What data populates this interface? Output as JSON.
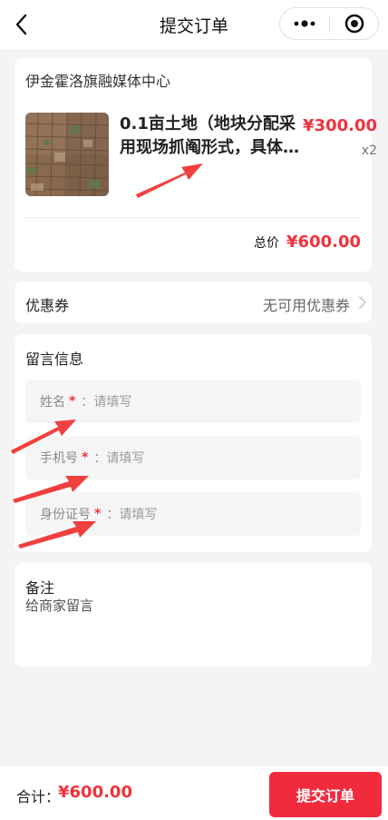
{
  "nav": {
    "title": "提交订单",
    "back_icon": "chevron-left-icon",
    "more_icon": "more-dots-icon",
    "close_icon": "target-circle-icon"
  },
  "shop": {
    "name": "伊金霍洛旗融媒体中心",
    "product": {
      "title": "0.1亩土地（地块分配采用现场抓阄形式，具体…",
      "price": "¥300.00",
      "qty": "x2",
      "image": "aerial-farmland-image"
    },
    "total_label": "总价",
    "total_value": "¥600.00"
  },
  "coupon": {
    "label": "优惠券",
    "value": "无可用优惠券"
  },
  "message": {
    "title": "留言信息",
    "fields": [
      {
        "label": "姓名",
        "required": "*",
        "placeholder": "：请填写"
      },
      {
        "label": "手机号",
        "required": "*",
        "placeholder": "：请填写"
      },
      {
        "label": "身份证号",
        "required": "*",
        "placeholder": "：请填写"
      }
    ]
  },
  "note": {
    "title": "备注",
    "placeholder": "给商家留言"
  },
  "footer": {
    "sum_label": "合计：",
    "sum_value": "¥600.00",
    "submit_label": "提交订单"
  },
  "colors": {
    "accent": "#f0323c",
    "button": "#f12b3e",
    "background": "#f4f4f4"
  }
}
